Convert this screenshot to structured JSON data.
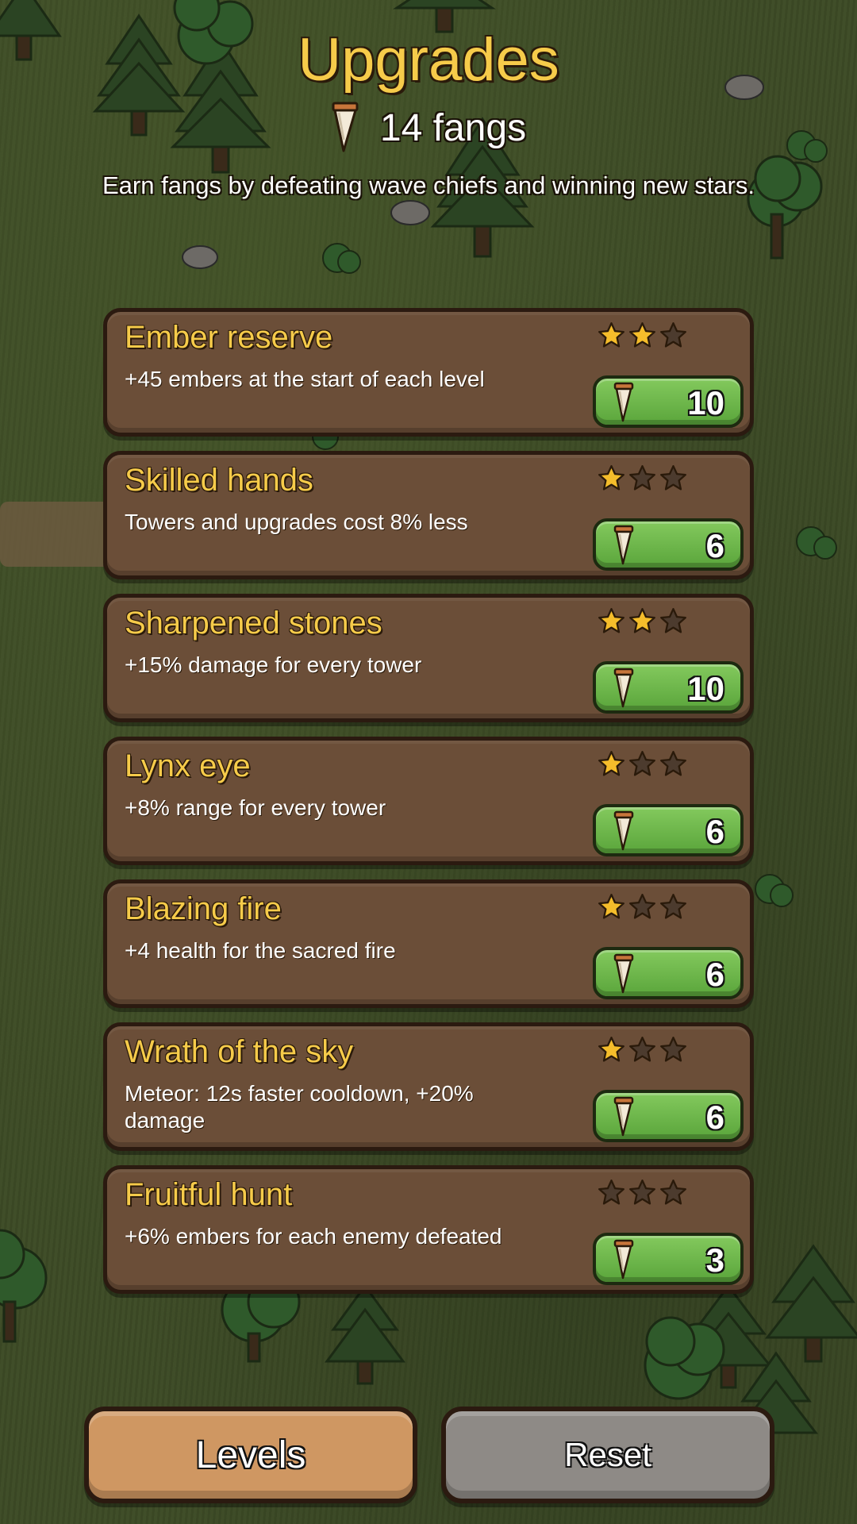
{
  "title": "Upgrades",
  "fangs": {
    "icon": "fang-icon",
    "count_text": "14 fangs"
  },
  "subtitle": "Earn fangs by defeating wave chiefs and winning new stars.",
  "colors": {
    "title_yellow": "#f6cb4a",
    "card_brown": "#6b4e38",
    "buy_green": "#6bb847",
    "star_filled": "#f5bd2b",
    "star_empty": "#4c3b2e",
    "levels_orange": "#cf9762",
    "reset_grey": "#8e8a86"
  },
  "upgrades": [
    {
      "name": "Ember reserve",
      "description": "+45 embers at the start of each level",
      "stars": 2,
      "max_stars": 3,
      "cost": "10"
    },
    {
      "name": "Skilled hands",
      "description": "Towers and upgrades cost 8% less",
      "stars": 1,
      "max_stars": 3,
      "cost": "6"
    },
    {
      "name": "Sharpened stones",
      "description": "+15% damage for every tower",
      "stars": 2,
      "max_stars": 3,
      "cost": "10"
    },
    {
      "name": "Lynx eye",
      "description": "+8% range for every tower",
      "stars": 1,
      "max_stars": 3,
      "cost": "6"
    },
    {
      "name": "Blazing fire",
      "description": "+4 health for the sacred fire",
      "stars": 1,
      "max_stars": 3,
      "cost": "6"
    },
    {
      "name": "Wrath of the sky",
      "description": "Meteor: 12s faster cooldown, +20% damage",
      "stars": 1,
      "max_stars": 3,
      "cost": "6"
    },
    {
      "name": "Fruitful hunt",
      "description": "+6% embers for each enemy defeated",
      "stars": 0,
      "max_stars": 3,
      "cost": "3"
    }
  ],
  "buttons": {
    "levels": "Levels",
    "reset": "Reset"
  }
}
